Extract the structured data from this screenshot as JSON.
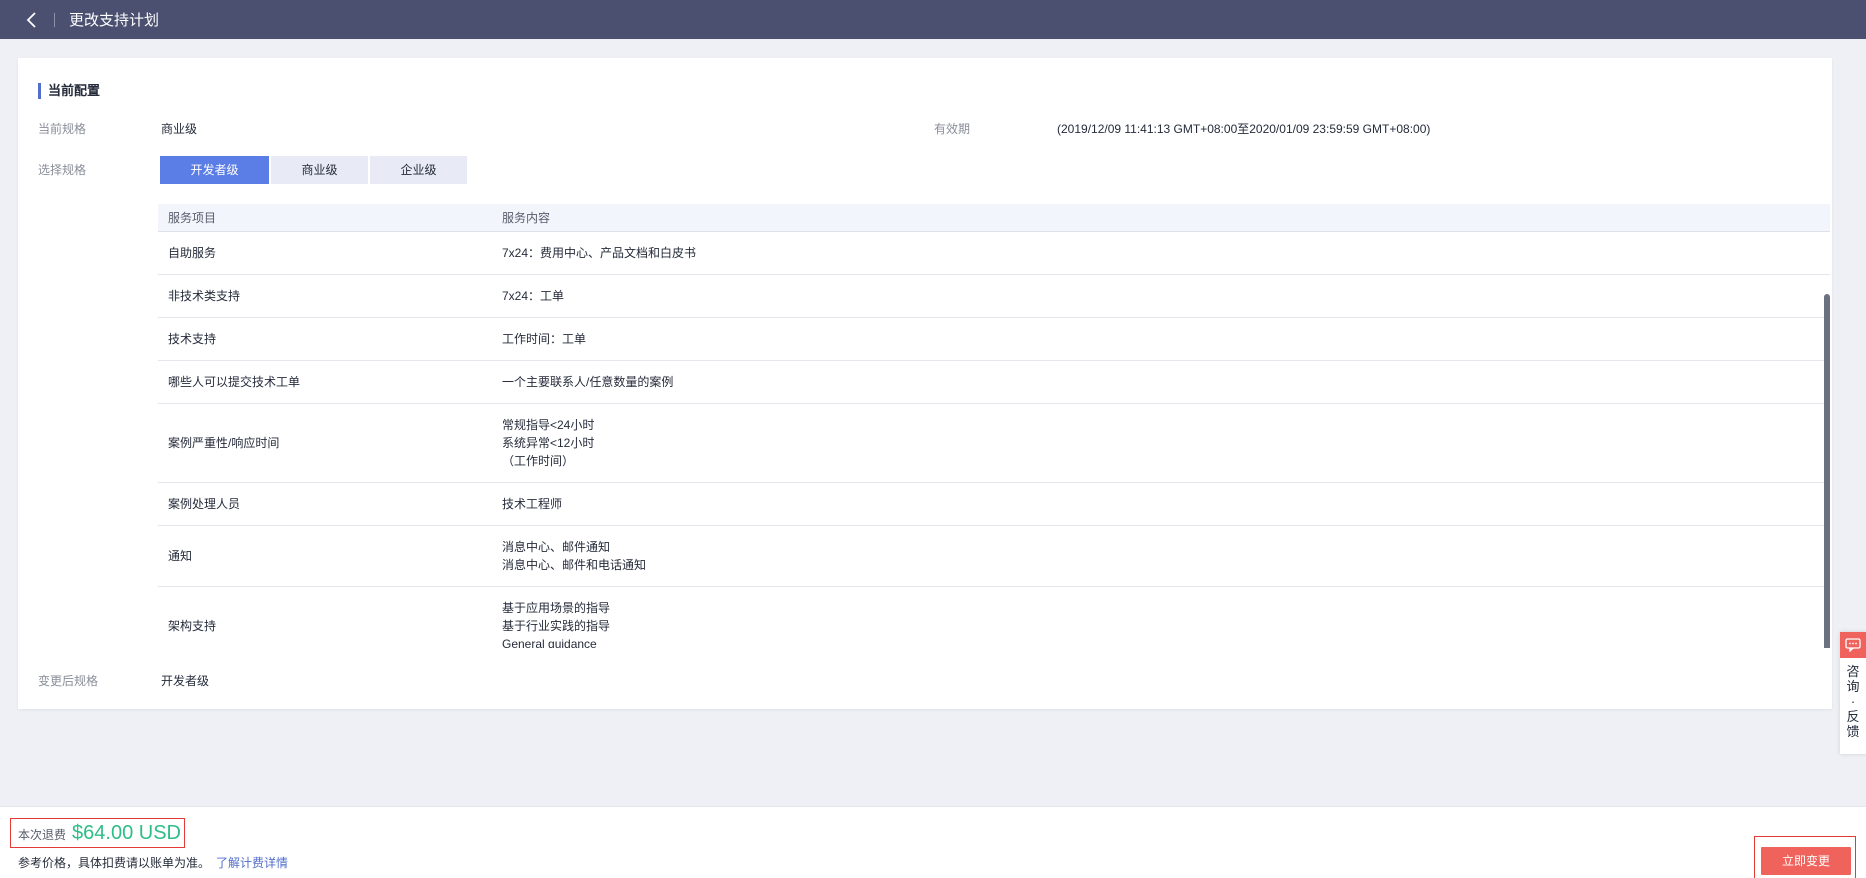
{
  "header": {
    "title": "更改支持计划"
  },
  "config": {
    "section_title": "当前配置",
    "current_spec_label": "当前规格",
    "current_spec_value": "商业级",
    "validity_label": "有效期",
    "validity_value": "(2019/12/09 11:41:13 GMT+08:00至2020/01/09 23:59:59 GMT+08:00)",
    "select_spec_label": "选择规格",
    "spec_tabs": [
      {
        "label": "开发者级",
        "selected": true
      },
      {
        "label": "商业级",
        "selected": false
      },
      {
        "label": "企业级",
        "selected": false
      }
    ],
    "table": {
      "headers": [
        "服务项目",
        "服务内容"
      ],
      "rows": [
        {
          "item": "自助服务",
          "content": [
            "7x24：费用中心、产品文档和白皮书"
          ]
        },
        {
          "item": "非技术类支持",
          "content": [
            "7x24：工单"
          ]
        },
        {
          "item": "技术支持",
          "content": [
            "工作时间：工单"
          ]
        },
        {
          "item": "哪些人可以提交技术工单",
          "content": [
            "一个主要联系人/任意数量的案例"
          ]
        },
        {
          "item": "案例严重性/响应时间",
          "content": [
            "常规指导<24小时",
            "系统异常<12小时",
            "（工作时间）"
          ]
        },
        {
          "item": "案例处理人员",
          "content": [
            "技术工程师"
          ]
        },
        {
          "item": "通知",
          "content": [
            "消息中心、邮件通知",
            "消息中心、邮件和电话通知"
          ]
        },
        {
          "item": "架构支持",
          "content": [
            "基于应用场景的指导",
            "基于行业实践的指导",
            "General guidance"
          ]
        }
      ]
    },
    "changed_spec_label": "变更后规格",
    "changed_spec_value": "开发者级"
  },
  "float_help": {
    "text": [
      "咨",
      "询",
      "·",
      "反",
      "馈"
    ],
    "icon": "chat-icon"
  },
  "footer": {
    "fee_label": "本次退费",
    "fee_amount": "$64.00 USD",
    "ref_note": "参考价格，具体扣费请以账单为准。",
    "ref_link": "了解计费详情",
    "confirm_label": "立即变更"
  },
  "colors": {
    "accent": "#5b7de6",
    "topbar": "#4b5071",
    "danger": "#f0625c",
    "fee": "#2ebd89"
  }
}
